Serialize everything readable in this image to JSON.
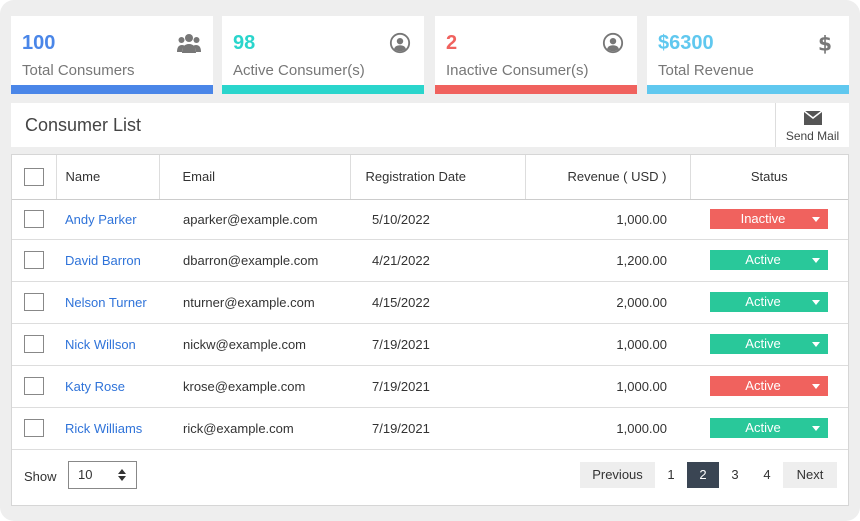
{
  "stats": [
    {
      "value": "100",
      "label": "Total Consumers",
      "icon": "users-icon"
    },
    {
      "value": "98",
      "label": "Active Consumer(s)",
      "icon": "user-circle-icon"
    },
    {
      "value": "2",
      "label": "Inactive Consumer(s)",
      "icon": "user-circle-icon"
    },
    {
      "value": "$6300",
      "label": "Total Revenue",
      "icon": "dollar-icon"
    }
  ],
  "list": {
    "title": "Consumer List",
    "send_mail_label": "Send Mail"
  },
  "table": {
    "headers": {
      "name": "Name",
      "email": "Email",
      "date": "Registration Date",
      "revenue": "Revenue ( USD )",
      "status": "Status"
    },
    "rows": [
      {
        "name": "Andy Parker",
        "email": "aparker@example.com",
        "date": "5/10/2022",
        "revenue": "1,000.00",
        "status": "Inactive",
        "status_color": "#f0625e"
      },
      {
        "name": "David Barron",
        "email": "dbarron@example.com",
        "date": "4/21/2022",
        "revenue": "1,200.00",
        "status": "Active",
        "status_color": "#29c89a"
      },
      {
        "name": "Nelson Turner",
        "email": "nturner@example.com",
        "date": "4/15/2022",
        "revenue": "2,000.00",
        "status": "Active",
        "status_color": "#29c89a"
      },
      {
        "name": "Nick Willson",
        "email": "nickw@example.com",
        "date": "7/19/2021",
        "revenue": "1,000.00",
        "status": "Active",
        "status_color": "#29c89a"
      },
      {
        "name": "Katy Rose",
        "email": "krose@example.com",
        "date": "7/19/2021",
        "revenue": "1,000.00",
        "status": "Active",
        "status_color": "#f0625e"
      },
      {
        "name": "Rick Williams",
        "email": "rick@example.com",
        "date": "7/19/2021",
        "revenue": "1,000.00",
        "status": "Active",
        "status_color": "#29c89a"
      }
    ]
  },
  "footer": {
    "show_label": "Show",
    "page_size": "10",
    "prev_label": "Previous",
    "next_label": "Next",
    "pages": [
      "1",
      "2",
      "3",
      "4"
    ],
    "current_page": "2"
  }
}
